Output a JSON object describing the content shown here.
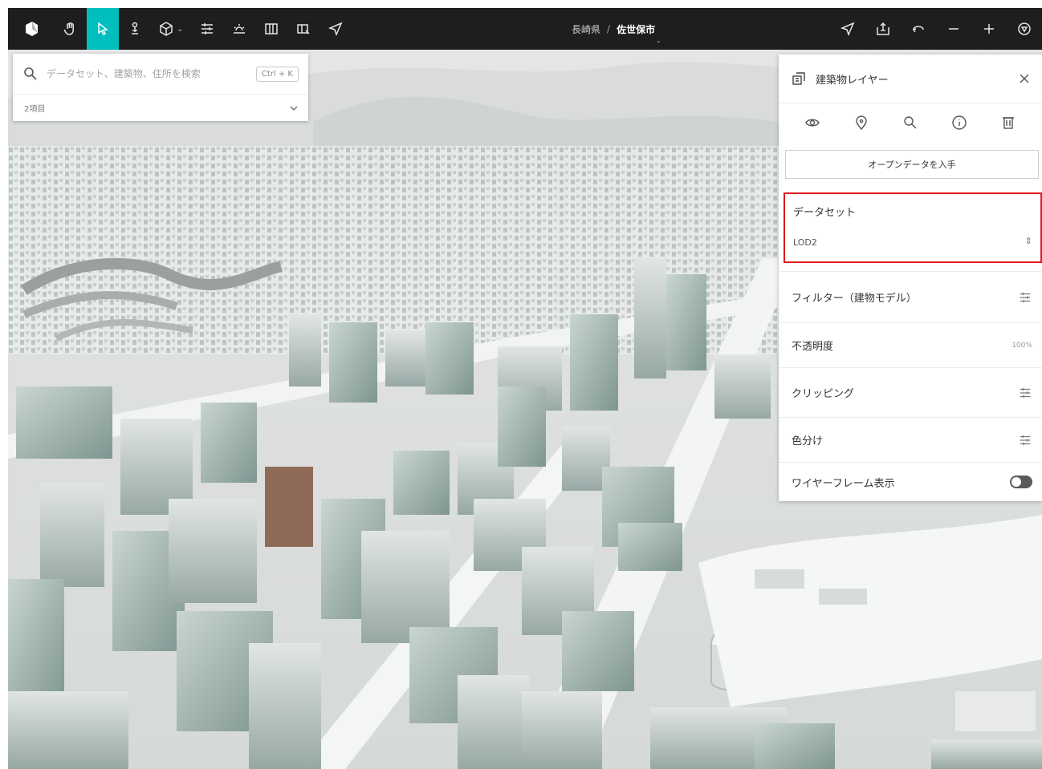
{
  "toolbar": {
    "tools": [
      {
        "name": "hand-icon",
        "active": false
      },
      {
        "name": "cursor-icon",
        "active": true
      },
      {
        "name": "pin-person-icon",
        "active": false
      },
      {
        "name": "cube-icon",
        "active": false,
        "dropdown": true
      },
      {
        "name": "sliders-icon",
        "active": false
      },
      {
        "name": "sun-horizon-icon",
        "active": false
      },
      {
        "name": "columns-icon",
        "active": false
      },
      {
        "name": "split-view-icon",
        "active": false
      },
      {
        "name": "send-icon",
        "active": false
      }
    ],
    "breadcrumb": {
      "prefecture": "長崎県",
      "separator": "/",
      "city": "佐世保市"
    },
    "right_tools": [
      "navigate-icon",
      "share-icon",
      "rotate-icon",
      "zoom-out-icon",
      "zoom-in-icon",
      "compass-icon"
    ],
    "accent": "#00bebe",
    "bg": "#1e1e1e"
  },
  "search": {
    "placeholder": "データセット、建築物、住所を検索",
    "shortcut": "Ctrl + K",
    "count_label": "2項目"
  },
  "layer_panel": {
    "title": "建築物レイヤー",
    "actions": [
      "eye-icon",
      "location-pin-icon",
      "search-icon",
      "info-icon",
      "trash-icon"
    ],
    "open_data_button": "オープンデータを入手",
    "dataset": {
      "label": "データセット",
      "value": "LOD2"
    },
    "rows": [
      {
        "label": "フィルター（建物モデル）",
        "control": "sliders-icon"
      },
      {
        "label": "不透明度",
        "value": "100%"
      },
      {
        "label": "クリッピング",
        "control": "sliders-icon"
      },
      {
        "label": "色分け",
        "control": "sliders-icon"
      },
      {
        "label": "ワイヤーフレーム表示",
        "control": "toggle",
        "on": false
      }
    ],
    "highlight_color": "#e0191e"
  }
}
